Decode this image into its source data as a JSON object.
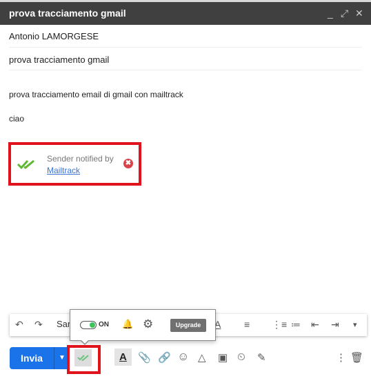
{
  "window": {
    "title": "prova tracciamento gmail",
    "minimize": "_",
    "expand": "⤢",
    "close": "✕"
  },
  "compose": {
    "recipient": "Antonio LAMORGESE",
    "subject": "prova tracciamento gmail",
    "body": [
      "prova tracciamento email di gmail con mailtrack",
      "ciao"
    ]
  },
  "notification": {
    "text": "Sender notified by",
    "link": "Mailtrack",
    "close": "✖",
    "accent": "#e0121c",
    "check_color": "#5cb82e"
  },
  "format_toolbar": {
    "undo": "↶",
    "redo": "↷",
    "font": "Sans",
    "text_color": "A",
    "align": "≡",
    "numbered": "⋮≡",
    "bulleted": "≔",
    "indent_less": "⇤",
    "indent_more": "⇥",
    "more": "▾"
  },
  "mailtrack_popup": {
    "toggle_state": "ON",
    "toggle_on": true,
    "bell": "🔔",
    "gear": "⚙",
    "upgrade": "Upgrade"
  },
  "bottom": {
    "send": "Invia",
    "send_more": "▼",
    "send_color": "#1a73e8",
    "icons": {
      "format": "A",
      "attach": "📎",
      "link": "🔗",
      "emoji": "☺",
      "drive": "△",
      "photo": "▣",
      "schedule": "⏲",
      "signature": "✎",
      "more": "⋮",
      "trash": "🗑"
    }
  }
}
